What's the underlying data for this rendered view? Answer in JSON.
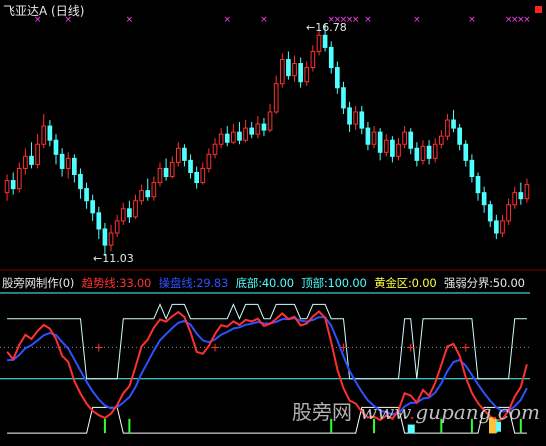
{
  "stock": {
    "title": "飞亚达A",
    "period": "(日线)"
  },
  "price_chart": {
    "high_label": "16.78",
    "low_label": "11.03",
    "colors": {
      "up": "#ff3030",
      "down": "#50ffff",
      "marker": "#ff40ff"
    }
  },
  "indicator": {
    "name": "股旁网制作(0)",
    "params": [
      {
        "label": "趋势线:33.00",
        "color": "#ff3030"
      },
      {
        "label": "操盘线:29.83",
        "color": "#3050ff"
      },
      {
        "label": "底部:40.00",
        "color": "#50ffff"
      },
      {
        "label": "顶部:100.00",
        "color": "#50ffff"
      },
      {
        "label": "黄金区:0.00",
        "color": "#ffff40"
      },
      {
        "label": "强弱分界:50.00",
        "color": "#e8e8e8"
      }
    ]
  },
  "watermark": {
    "cn": "股旁网",
    "www": "www",
    "dot": ".",
    "domain": "gupang",
    "dot2": ".",
    "tld": "com"
  },
  "chart_data": {
    "type": "candlestick",
    "price_high": 16.78,
    "price_low": 11.03,
    "candles": [
      [
        12.6,
        12.9,
        13.05,
        12.4
      ],
      [
        12.9,
        12.7,
        13.1,
        12.55
      ],
      [
        12.7,
        13.2,
        13.35,
        12.6
      ],
      [
        13.2,
        13.5,
        13.7,
        13.05
      ],
      [
        13.5,
        13.3,
        13.85,
        13.2
      ],
      [
        13.3,
        13.8,
        14.05,
        13.2
      ],
      [
        13.8,
        14.25,
        14.55,
        13.7
      ],
      [
        14.25,
        13.9,
        14.4,
        13.75
      ],
      [
        13.9,
        13.55,
        14.05,
        13.3
      ],
      [
        13.55,
        13.2,
        13.7,
        13.0
      ],
      [
        13.2,
        13.45,
        13.6,
        12.95
      ],
      [
        13.45,
        13.05,
        13.55,
        12.85
      ],
      [
        13.05,
        12.7,
        13.2,
        12.45
      ],
      [
        12.7,
        12.4,
        12.85,
        12.2
      ],
      [
        12.4,
        12.1,
        12.55,
        11.9
      ],
      [
        12.1,
        11.7,
        12.25,
        11.45
      ],
      [
        11.7,
        11.3,
        11.85,
        11.03
      ],
      [
        11.3,
        11.6,
        11.8,
        11.15
      ],
      [
        11.6,
        11.9,
        12.05,
        11.5
      ],
      [
        11.9,
        12.2,
        12.35,
        11.8
      ],
      [
        12.2,
        12.0,
        12.4,
        11.85
      ],
      [
        12.0,
        12.4,
        12.55,
        11.95
      ],
      [
        12.4,
        12.65,
        12.8,
        12.3
      ],
      [
        12.65,
        12.5,
        12.95,
        12.4
      ],
      [
        12.5,
        12.85,
        13.0,
        12.4
      ],
      [
        12.85,
        13.2,
        13.35,
        12.75
      ],
      [
        13.2,
        13.0,
        13.45,
        12.9
      ],
      [
        13.0,
        13.35,
        13.5,
        12.95
      ],
      [
        13.35,
        13.7,
        13.85,
        13.25
      ],
      [
        13.7,
        13.4,
        13.8,
        13.25
      ],
      [
        13.4,
        13.1,
        13.55,
        12.95
      ],
      [
        13.1,
        12.85,
        13.25,
        12.7
      ],
      [
        12.85,
        13.2,
        13.35,
        12.8
      ],
      [
        13.2,
        13.55,
        13.7,
        13.1
      ],
      [
        13.55,
        13.8,
        13.95,
        13.45
      ],
      [
        13.8,
        14.05,
        14.2,
        13.7
      ],
      [
        14.05,
        13.85,
        14.25,
        13.75
      ],
      [
        13.85,
        14.1,
        14.3,
        13.8
      ],
      [
        14.1,
        13.9,
        14.35,
        13.8
      ],
      [
        13.9,
        14.2,
        14.4,
        13.85
      ],
      [
        14.2,
        14.05,
        14.35,
        13.95
      ],
      [
        14.05,
        14.3,
        14.5,
        13.95
      ],
      [
        14.3,
        14.15,
        14.45,
        14.0
      ],
      [
        14.15,
        14.6,
        14.8,
        14.1
      ],
      [
        14.6,
        15.3,
        15.5,
        14.55
      ],
      [
        15.3,
        15.9,
        16.05,
        15.2
      ],
      [
        15.9,
        15.5,
        16.1,
        15.4
      ],
      [
        15.5,
        15.8,
        16.0,
        15.35
      ],
      [
        15.8,
        15.35,
        15.95,
        15.2
      ],
      [
        15.35,
        15.7,
        15.85,
        15.25
      ],
      [
        15.7,
        16.1,
        16.25,
        15.6
      ],
      [
        16.1,
        16.5,
        16.65,
        16.0
      ],
      [
        16.5,
        16.2,
        16.78,
        16.1
      ],
      [
        16.2,
        15.7,
        16.35,
        15.55
      ],
      [
        15.7,
        15.2,
        15.85,
        15.05
      ],
      [
        15.2,
        14.7,
        15.35,
        14.55
      ],
      [
        14.7,
        14.3,
        14.85,
        14.1
      ],
      [
        14.3,
        14.6,
        14.75,
        14.15
      ],
      [
        14.6,
        14.2,
        14.75,
        14.05
      ],
      [
        14.2,
        13.8,
        14.35,
        13.65
      ],
      [
        13.8,
        14.1,
        14.25,
        13.7
      ],
      [
        14.1,
        13.6,
        14.2,
        13.4
      ],
      [
        13.6,
        13.9,
        14.05,
        13.5
      ],
      [
        13.9,
        13.5,
        14.0,
        13.35
      ],
      [
        13.5,
        13.8,
        13.95,
        13.4
      ],
      [
        13.8,
        14.1,
        14.25,
        13.7
      ],
      [
        14.1,
        13.7,
        14.2,
        13.55
      ],
      [
        13.7,
        13.4,
        13.85,
        13.25
      ],
      [
        13.4,
        13.75,
        13.9,
        13.3
      ],
      [
        13.75,
        13.45,
        13.9,
        13.3
      ],
      [
        13.45,
        13.8,
        13.95,
        13.35
      ],
      [
        13.8,
        14.0,
        14.15,
        13.7
      ],
      [
        14.0,
        14.4,
        14.55,
        13.9
      ],
      [
        14.4,
        14.2,
        14.65,
        14.1
      ],
      [
        14.2,
        13.8,
        14.3,
        13.65
      ],
      [
        13.8,
        13.4,
        13.9,
        13.25
      ],
      [
        13.4,
        13.0,
        13.55,
        12.85
      ],
      [
        13.0,
        12.6,
        13.1,
        12.4
      ],
      [
        12.6,
        12.3,
        12.75,
        12.1
      ],
      [
        12.3,
        11.9,
        12.4,
        11.75
      ],
      [
        11.9,
        11.6,
        12.05,
        11.45
      ],
      [
        11.6,
        11.9,
        12.05,
        11.5
      ],
      [
        11.9,
        12.3,
        12.45,
        11.8
      ],
      [
        12.3,
        12.6,
        12.75,
        12.2
      ],
      [
        12.6,
        12.45,
        12.85,
        12.3
      ],
      [
        12.45,
        12.8,
        12.95,
        12.35
      ]
    ],
    "markers_top": [
      5,
      10,
      20,
      36,
      42,
      53,
      54,
      55,
      56,
      57,
      59,
      67,
      76,
      82,
      83,
      84,
      85,
      92,
      104
    ]
  }
}
